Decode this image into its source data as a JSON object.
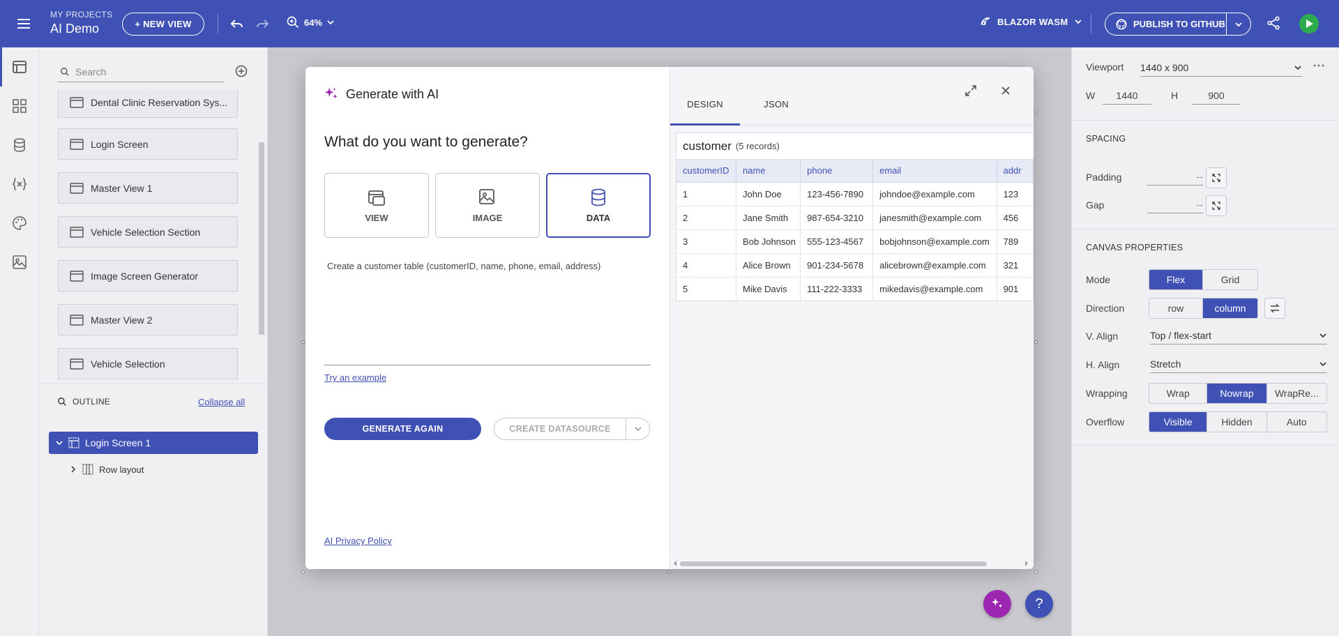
{
  "topbar": {
    "project_sub": "MY PROJECTS",
    "project_title": "AI Demo",
    "new_view": "+ NEW VIEW",
    "zoom": "64%",
    "framework": "BLAZOR WASM",
    "publish": "PUBLISH TO GITHUB",
    "color": "#3f51b5"
  },
  "left_panel": {
    "search_placeholder": "Search",
    "pages": [
      "Dental Clinic Reservation Sys...",
      "Login Screen",
      "Master View 1",
      "Vehicle Selection Section",
      "Image Screen Generator",
      "Master View 2",
      "Vehicle Selection"
    ],
    "outline_title": "OUTLINE",
    "collapse_all": "Collapse all",
    "tree": {
      "selected": "Login Screen 1",
      "child": "Row layout"
    }
  },
  "modal": {
    "title": "Generate with AI",
    "question": "What do you want to generate?",
    "choices": [
      "VIEW",
      "IMAGE",
      "DATA"
    ],
    "selected_choice": "DATA",
    "prompt": "Create a customer table (customerID, name, phone, email, address)",
    "try_example": "Try an example",
    "generate_again": "GENERATE AGAIN",
    "create_datasource": "CREATE DATASOURCE",
    "privacy": "AI Privacy Policy",
    "tabs": [
      "DESIGN",
      "JSON"
    ],
    "active_tab": "DESIGN",
    "grid": {
      "name": "customer",
      "count": "(5 records)",
      "columns": [
        "customerID",
        "name",
        "phone",
        "email",
        "addr"
      ],
      "rows": [
        [
          "1",
          "John Doe",
          "123-456-7890",
          "johndoe@example.com",
          "123"
        ],
        [
          "2",
          "Jane Smith",
          "987-654-3210",
          "janesmith@example.com",
          "456"
        ],
        [
          "3",
          "Bob Johnson",
          "555-123-4567",
          "bobjohnson@example.com",
          "789"
        ],
        [
          "4",
          "Alice Brown",
          "901-234-5678",
          "alicebrown@example.com",
          "321"
        ],
        [
          "5",
          "Mike Davis",
          "111-222-3333",
          "mikedavis@example.com",
          "901"
        ]
      ]
    }
  },
  "props": {
    "viewport_label": "Viewport",
    "viewport_value": "1440 x 900",
    "w_label": "W",
    "w_value": "1440",
    "h_label": "H",
    "h_value": "900",
    "spacing_title": "SPACING",
    "padding_label": "Padding",
    "padding_value": "--",
    "gap_label": "Gap",
    "gap_value": "--",
    "canvas_title": "CANVAS PROPERTIES",
    "mode_label": "Mode",
    "mode_options": [
      "Flex",
      "Grid"
    ],
    "direction_label": "Direction",
    "direction_options": [
      "row",
      "column"
    ],
    "valign_label": "V. Align",
    "valign_value": "Top / flex-start",
    "halign_label": "H. Align",
    "halign_value": "Stretch",
    "wrapping_label": "Wrapping",
    "wrapping_options": [
      "Wrap",
      "Nowrap",
      "WrapRe..."
    ],
    "overflow_label": "Overflow",
    "overflow_options": [
      "Visible",
      "Hidden",
      "Auto"
    ]
  },
  "fabs": {
    "ai_color": "#9c27b0",
    "help_color": "#3f51b5",
    "help_label": "?"
  }
}
